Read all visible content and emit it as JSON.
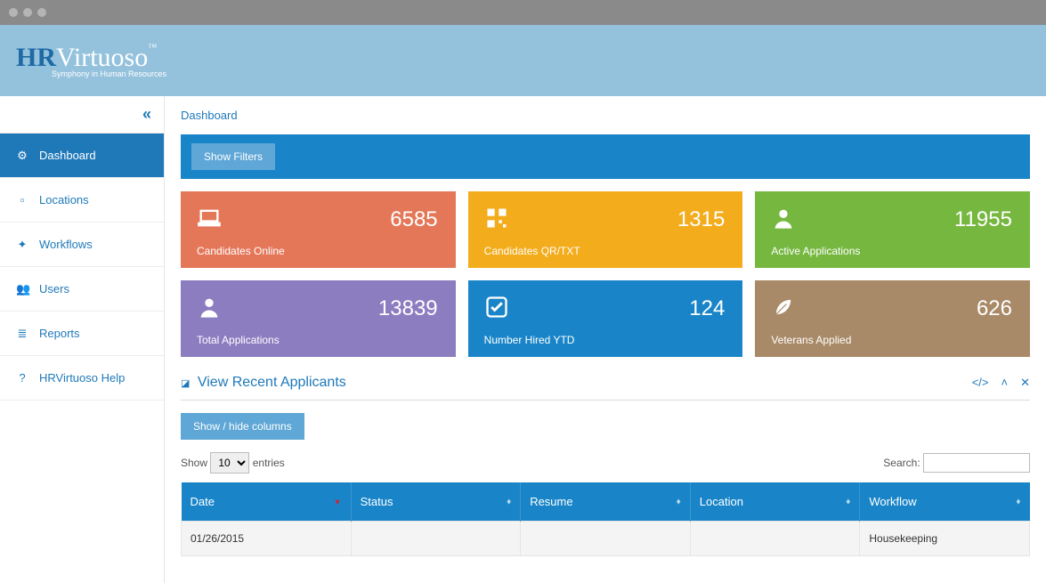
{
  "brand": {
    "hr": "HR",
    "rest": "Virtuoso",
    "tm": "™",
    "tagline": "Symphony in Human Resources"
  },
  "breadcrumb": "Dashboard",
  "filterbar": {
    "show_filters": "Show Filters"
  },
  "sidebar": {
    "items": [
      {
        "label": "Dashboard",
        "icon": "⚙"
      },
      {
        "label": "Locations",
        "icon": "▫"
      },
      {
        "label": "Workflows",
        "icon": "✦"
      },
      {
        "label": "Users",
        "icon": "👥"
      },
      {
        "label": "Reports",
        "icon": "≣"
      },
      {
        "label": "HRVirtuoso Help",
        "icon": "?"
      }
    ]
  },
  "cards": [
    {
      "label": "Candidates Online",
      "value": "6585",
      "icon": "laptop"
    },
    {
      "label": "Candidates QR/TXT",
      "value": "1315",
      "icon": "qr"
    },
    {
      "label": "Active Applications",
      "value": "11955",
      "icon": "user"
    },
    {
      "label": "Total Applications",
      "value": "13839",
      "icon": "user"
    },
    {
      "label": "Number Hired YTD",
      "value": "124",
      "icon": "check"
    },
    {
      "label": "Veterans Applied",
      "value": "626",
      "icon": "leaf"
    }
  ],
  "panel": {
    "title": "View Recent Applicants",
    "show_hide": "Show / hide columns",
    "show_label_pre": "Show",
    "show_label_post": "entries",
    "page_size": "10",
    "search_label": "Search:",
    "columns": [
      "Date",
      "Status",
      "Resume",
      "Location",
      "Workflow"
    ],
    "rows": [
      {
        "date": "01/26/2015",
        "status": "",
        "resume": "",
        "location": "",
        "workflow": "Housekeeping"
      }
    ]
  }
}
